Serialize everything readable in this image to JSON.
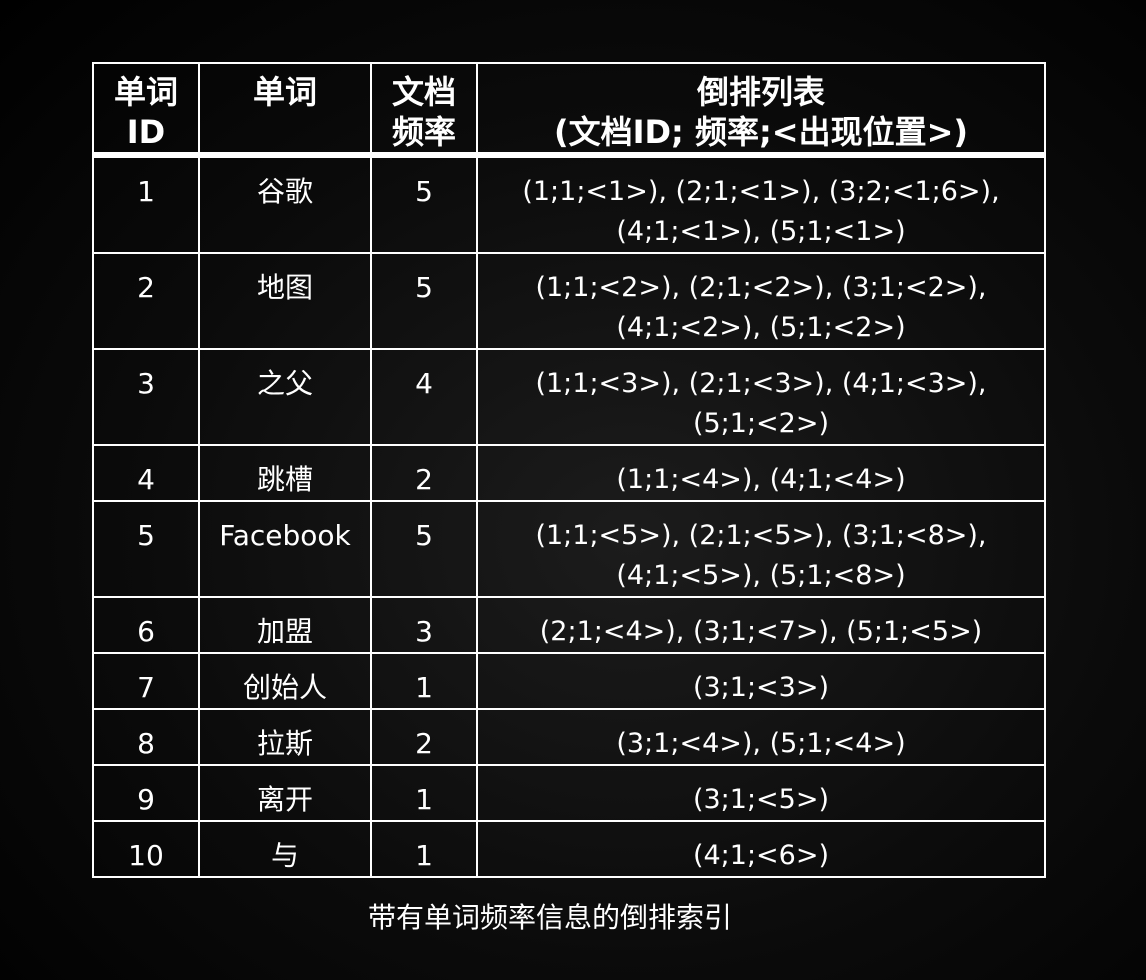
{
  "table": {
    "headers": {
      "word_id": "单词\nID",
      "word": "单词",
      "doc_freq": "文档\n频率",
      "postings": "倒排列表\n(文档ID; 频率;<出现位置>)"
    },
    "rows": [
      {
        "id": "1",
        "word": "谷歌",
        "df": "5",
        "postings": "(1;1;<1>), (2;1;<1>), (3;2;<1;6>),\n(4;1;<1>), (5;1;<1>)"
      },
      {
        "id": "2",
        "word": "地图",
        "df": "5",
        "postings": "(1;1;<2>), (2;1;<2>), (3;1;<2>),\n(4;1;<2>), (5;1;<2>)"
      },
      {
        "id": "3",
        "word": "之父",
        "df": "4",
        "postings": "(1;1;<3>), (2;1;<3>), (4;1;<3>),\n(5;1;<2>)"
      },
      {
        "id": "4",
        "word": "跳槽",
        "df": "2",
        "postings": "(1;1;<4>), (4;1;<4>)"
      },
      {
        "id": "5",
        "word": "Facebook",
        "df": "5",
        "postings": "(1;1;<5>), (2;1;<5>), (3;1;<8>),\n(4;1;<5>), (5;1;<8>)"
      },
      {
        "id": "6",
        "word": "加盟",
        "df": "3",
        "postings": "(2;1;<4>), (3;1;<7>), (5;1;<5>)"
      },
      {
        "id": "7",
        "word": "创始人",
        "df": "1",
        "postings": "(3;1;<3>)"
      },
      {
        "id": "8",
        "word": "拉斯",
        "df": "2",
        "postings": "(3;1;<4>), (5;1;<4>)"
      },
      {
        "id": "9",
        "word": "离开",
        "df": "1",
        "postings": "(3;1;<5>)"
      },
      {
        "id": "10",
        "word": "与",
        "df": "1",
        "postings": "(4;1;<6>)"
      }
    ]
  },
  "caption": "带有单词频率信息的倒排索引"
}
